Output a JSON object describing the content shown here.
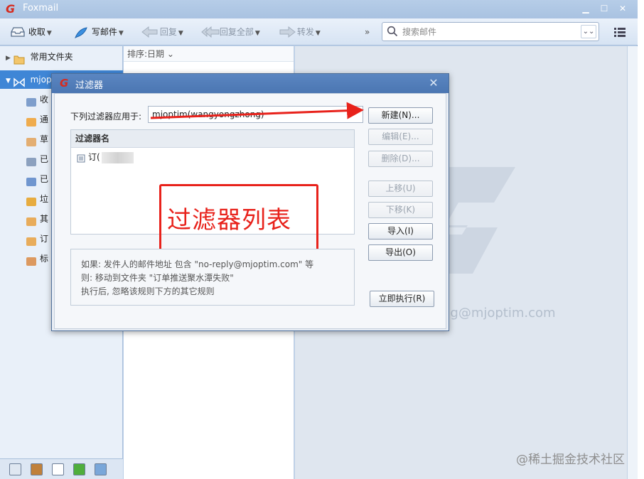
{
  "app": {
    "title": "Foxmail",
    "logo": "G"
  },
  "window_buttons": [
    "minimize-icon",
    "maximize-icon",
    "close-icon"
  ],
  "toolbar": {
    "receive": "收取",
    "compose": "写邮件",
    "reply": "回复",
    "reply_all": "回复全部",
    "forward": "转发",
    "more": "»",
    "search_placeholder": "搜索邮件"
  },
  "sidebar": {
    "common_folder": "常用文件夹",
    "account": "mjop",
    "folders": [
      {
        "label": "收",
        "icon": "inbox-icon"
      },
      {
        "label": "通",
        "icon": "notify-icon"
      },
      {
        "label": "草",
        "icon": "draft-icon"
      },
      {
        "label": "已",
        "icon": "sent-icon"
      },
      {
        "label": "已",
        "icon": "deleted-icon"
      },
      {
        "label": "垃",
        "icon": "junk-icon"
      },
      {
        "label": "其",
        "icon": "other-folder-icon"
      },
      {
        "label": "订",
        "icon": "subscription-folder-icon"
      },
      {
        "label": "标",
        "icon": "tag-folder-icon"
      }
    ]
  },
  "list": {
    "sort_label": "排序:日期 ⌄"
  },
  "reading": {
    "email_fragment": "ng@mjoptim.com"
  },
  "watermark": "@稀土掘金技术社区",
  "dialog": {
    "title": "过滤器",
    "apply_label": "下列过滤器应用于:",
    "apply_value": "mjoptim(wangyongzhong)",
    "list_header": "过滤器名",
    "filter_row": "订(",
    "annotation": "过滤器列表",
    "desc": [
      "如果: 发件人的邮件地址 包含 \"no-reply@mjoptim.com\" 等",
      "则: 移动到文件夹 \"订单推送聚水潭失败\"",
      "执行后, 忽略该规则下方的其它规则"
    ],
    "buttons": {
      "new": "新建(N)...",
      "edit": "编辑(E)...",
      "delete": "删除(D)...",
      "move_up": "上移(U)",
      "move_down": "下移(K)",
      "import": "导入(I)",
      "export": "导出(O)",
      "run_now": "立即执行(R)"
    }
  },
  "colors": {
    "annotation_red": "#e8221b",
    "selection_blue": "#3f86d6"
  }
}
